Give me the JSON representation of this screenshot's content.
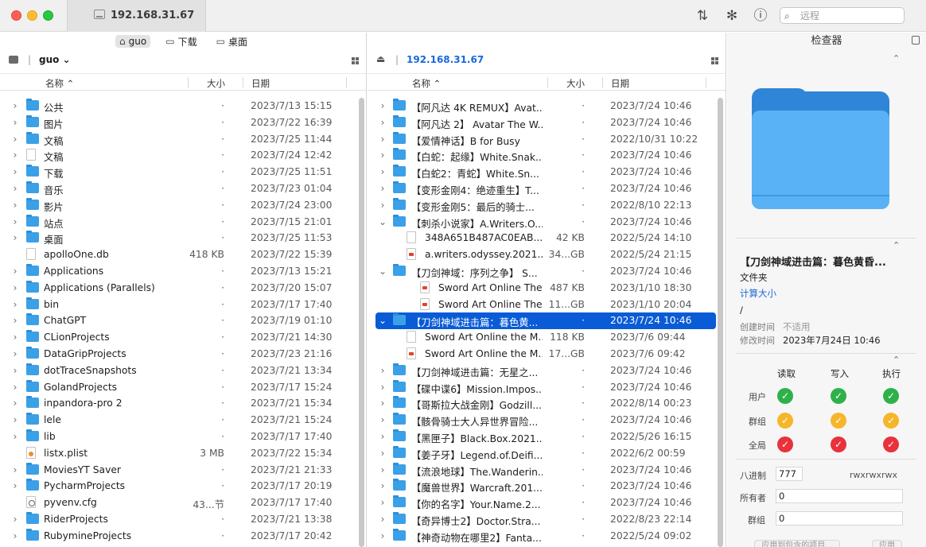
{
  "window": {
    "tab_title": "192.168.31.67",
    "search_placeholder": "远程",
    "toolbar_icons": [
      "transfer-icon",
      "activity-icon",
      "info-icon",
      "search-icon"
    ]
  },
  "left": {
    "favorites": [
      {
        "label": "guo",
        "icon": "home-icon",
        "active": true
      },
      {
        "label": "下载",
        "icon": "folder-icon",
        "active": false
      },
      {
        "label": "桌面",
        "icon": "folder-icon",
        "active": false
      }
    ],
    "path": "guo ⌄",
    "columns": {
      "name": "名称",
      "size": "大小",
      "date": "日期"
    },
    "rows": [
      {
        "expand": true,
        "icon": "folder",
        "name": "公共",
        "size": "·",
        "date": "2023/7/13 15:15"
      },
      {
        "expand": true,
        "icon": "folder",
        "name": "图片",
        "size": "·",
        "date": "2023/7/22 16:39"
      },
      {
        "expand": true,
        "icon": "folder",
        "name": "文稿",
        "size": "·",
        "date": "2023/7/25 11:44"
      },
      {
        "expand": true,
        "icon": "doc",
        "name": "文稿",
        "size": "·",
        "date": "2023/7/24 12:42"
      },
      {
        "expand": true,
        "icon": "folder",
        "name": "下载",
        "size": "·",
        "date": "2023/7/25 11:51"
      },
      {
        "expand": true,
        "icon": "folder",
        "name": "音乐",
        "size": "·",
        "date": "2023/7/23 01:04"
      },
      {
        "expand": true,
        "icon": "folder",
        "name": "影片",
        "size": "·",
        "date": "2023/7/24 23:00"
      },
      {
        "expand": true,
        "icon": "folder",
        "name": "站点",
        "size": "·",
        "date": "2023/7/15 21:01"
      },
      {
        "expand": true,
        "icon": "folder",
        "name": "桌面",
        "size": "·",
        "date": "2023/7/25 11:53"
      },
      {
        "expand": false,
        "icon": "doc",
        "name": "apolloOne.db",
        "size": "418 KB",
        "date": "2023/7/22 15:39"
      },
      {
        "expand": true,
        "icon": "folder",
        "name": "Applications",
        "size": "·",
        "date": "2023/7/13 15:21"
      },
      {
        "expand": true,
        "icon": "folder",
        "name": "Applications (Parallels)",
        "size": "·",
        "date": "2023/7/20 15:07"
      },
      {
        "expand": true,
        "icon": "folder",
        "name": "bin",
        "size": "·",
        "date": "2023/7/17 17:40"
      },
      {
        "expand": true,
        "icon": "folder",
        "name": "ChatGPT",
        "size": "·",
        "date": "2023/7/19 01:10"
      },
      {
        "expand": true,
        "icon": "folder",
        "name": "CLionProjects",
        "size": "·",
        "date": "2023/7/21 14:30"
      },
      {
        "expand": true,
        "icon": "folder",
        "name": "DataGripProjects",
        "size": "·",
        "date": "2023/7/23 21:16"
      },
      {
        "expand": true,
        "icon": "folder",
        "name": "dotTraceSnapshots",
        "size": "·",
        "date": "2023/7/21 13:34"
      },
      {
        "expand": true,
        "icon": "folder",
        "name": "GolandProjects",
        "size": "·",
        "date": "2023/7/17 15:24"
      },
      {
        "expand": true,
        "icon": "folder",
        "name": "inpandora-pro 2",
        "size": "·",
        "date": "2023/7/21 15:34"
      },
      {
        "expand": true,
        "icon": "folder",
        "name": "lele",
        "size": "·",
        "date": "2023/7/21 15:24"
      },
      {
        "expand": true,
        "icon": "folder",
        "name": "lib",
        "size": "·",
        "date": "2023/7/17 17:40"
      },
      {
        "expand": false,
        "icon": "rss",
        "name": "listx.plist",
        "size": "3 MB",
        "date": "2023/7/22 15:34"
      },
      {
        "expand": true,
        "icon": "folder",
        "name": "MoviesYT Saver",
        "size": "·",
        "date": "2023/7/21 21:33"
      },
      {
        "expand": true,
        "icon": "folder",
        "name": "PycharmProjects",
        "size": "·",
        "date": "2023/7/17 20:19"
      },
      {
        "expand": false,
        "icon": "gear",
        "name": "pyvenv.cfg",
        "size": "43...节",
        "date": "2023/7/17 17:40"
      },
      {
        "expand": true,
        "icon": "folder",
        "name": "RiderProjects",
        "size": "·",
        "date": "2023/7/21 13:38"
      },
      {
        "expand": true,
        "icon": "folder",
        "name": "RubymineProjects",
        "size": "·",
        "date": "2023/7/17 20:42"
      }
    ]
  },
  "middle": {
    "path": "192.168.31.67",
    "columns": {
      "name": "名称",
      "size": "大小",
      "date": "日期"
    },
    "rows": [
      {
        "chev": "›",
        "indent": 0,
        "icon": "folder",
        "name": "【阿凡达 4K REMUX】Avat...",
        "size": "·",
        "date": "2023/7/24 10:46"
      },
      {
        "chev": "›",
        "indent": 0,
        "icon": "folder",
        "name": "【阿凡达 2】 Avatar The W...",
        "size": "·",
        "date": "2023/7/24 10:46"
      },
      {
        "chev": "›",
        "indent": 0,
        "icon": "folder",
        "name": "【爱情神话】B for Busy",
        "size": "·",
        "date": "2022/10/31 10:22"
      },
      {
        "chev": "›",
        "indent": 0,
        "icon": "folder",
        "name": "【白蛇：起缘】White.Snak...",
        "size": "·",
        "date": "2023/7/24 10:46"
      },
      {
        "chev": "›",
        "indent": 0,
        "icon": "folder",
        "name": "【白蛇2：青蛇】White.Sn...",
        "size": "·",
        "date": "2023/7/24 10:46"
      },
      {
        "chev": "›",
        "indent": 0,
        "icon": "folder",
        "name": "【变形金刚4：绝迹重生】T...",
        "size": "·",
        "date": "2023/7/24 10:46"
      },
      {
        "chev": "›",
        "indent": 0,
        "icon": "folder",
        "name": "【变形金刚5：最后的骑士...",
        "size": "·",
        "date": "2022/8/10 22:13"
      },
      {
        "chev": "⌄",
        "indent": 0,
        "icon": "folder",
        "name": "【刺杀小说家】A.Writers.O...",
        "size": "·",
        "date": "2023/7/24 10:46"
      },
      {
        "chev": "",
        "indent": 1,
        "icon": "doc",
        "name": "348A651B487AC0EAB...",
        "size": "42 KB",
        "date": "2022/5/24 14:10"
      },
      {
        "chev": "",
        "indent": 1,
        "icon": "pdf",
        "name": "a.writers.odyssey.2021....",
        "size": "34...GB",
        "date": "2022/5/24 21:15"
      },
      {
        "chev": "⌄",
        "indent": 0,
        "icon": "folder",
        "name": "【刀剑神域：序列之争】 S...",
        "size": "·",
        "date": "2023/7/24 10:46"
      },
      {
        "chev": "",
        "indent": 2,
        "icon": "pdf",
        "name": "Sword Art Online The...",
        "size": "487 KB",
        "date": "2023/1/10 18:30"
      },
      {
        "chev": "",
        "indent": 2,
        "icon": "pdf",
        "name": "Sword Art Online The...",
        "size": "11...GB",
        "date": "2023/1/10 20:04"
      },
      {
        "chev": "⌄",
        "indent": 0,
        "icon": "folder",
        "name": "【刀剑神域进击篇：暮色黄...",
        "size": "·",
        "date": "2023/7/24 10:46",
        "selected": true
      },
      {
        "chev": "",
        "indent": 1,
        "icon": "doc",
        "name": "Sword Art Online the M...",
        "size": "118 KB",
        "date": "2023/7/6 09:44"
      },
      {
        "chev": "",
        "indent": 1,
        "icon": "pdf",
        "name": "Sword Art Online the M...",
        "size": "17...GB",
        "date": "2023/7/6 09:42"
      },
      {
        "chev": "›",
        "indent": 0,
        "icon": "folder",
        "name": "【刀剑神域进击篇：无星之...",
        "size": "·",
        "date": "2023/7/24 10:46"
      },
      {
        "chev": "›",
        "indent": 0,
        "icon": "folder",
        "name": "【碟中谍6】Mission.Impos...",
        "size": "·",
        "date": "2023/7/24 10:46"
      },
      {
        "chev": "›",
        "indent": 0,
        "icon": "folder",
        "name": "【哥斯拉大战金刚】Godzill...",
        "size": "·",
        "date": "2022/8/14 00:23"
      },
      {
        "chev": "›",
        "indent": 0,
        "icon": "folder",
        "name": "【骸骨骑士大人异世界冒险...",
        "size": "·",
        "date": "2023/7/24 10:46"
      },
      {
        "chev": "›",
        "indent": 0,
        "icon": "folder",
        "name": "【黑匣子】Black.Box.2021...",
        "size": "·",
        "date": "2022/5/26 16:15"
      },
      {
        "chev": "›",
        "indent": 0,
        "icon": "folder",
        "name": "【姜子牙】Legend.of.Deifi...",
        "size": "·",
        "date": "2022/6/2 00:59"
      },
      {
        "chev": "›",
        "indent": 0,
        "icon": "folder",
        "name": "【流浪地球】The.Wanderin...",
        "size": "·",
        "date": "2023/7/24 10:46"
      },
      {
        "chev": "›",
        "indent": 0,
        "icon": "folder",
        "name": "【魔兽世界】Warcraft.201...",
        "size": "·",
        "date": "2023/7/24 10:46"
      },
      {
        "chev": "›",
        "indent": 0,
        "icon": "folder",
        "name": "【你的名字】Your.Name.2...",
        "size": "·",
        "date": "2023/7/24 10:46"
      },
      {
        "chev": "›",
        "indent": 0,
        "icon": "folder",
        "name": "【奇异博士2】Doctor.Stra...",
        "size": "·",
        "date": "2022/8/23 22:14"
      },
      {
        "chev": "›",
        "indent": 0,
        "icon": "folder",
        "name": "【神奇动物在哪里2】Fanta...",
        "size": "·",
        "date": "2022/5/24 09:02"
      }
    ]
  },
  "inspector": {
    "title": "检查器",
    "name": "【刀剑神域进击篇：暮色黄昏...",
    "kind": "文件夹",
    "calc_size": "计算大小",
    "path": "/",
    "created_label": "创建时间",
    "created_value": "不适用",
    "modified_label": "修改时间",
    "modified_value": "2023年7月24日 10:46",
    "perm_cols": [
      "读取",
      "写入",
      "执行"
    ],
    "perm_rows": [
      {
        "label": "用户",
        "state": "green"
      },
      {
        "label": "群组",
        "state": "yellow"
      },
      {
        "label": "全局",
        "state": "red"
      }
    ],
    "octal_label": "八进制",
    "octal_value": "777",
    "rwx": "rwxrwxrwx",
    "owner_label": "所有者",
    "owner_value": "0",
    "group_label": "群组",
    "group_value": "0",
    "apply_children": "应用到包含的项目...",
    "apply": "应用"
  }
}
